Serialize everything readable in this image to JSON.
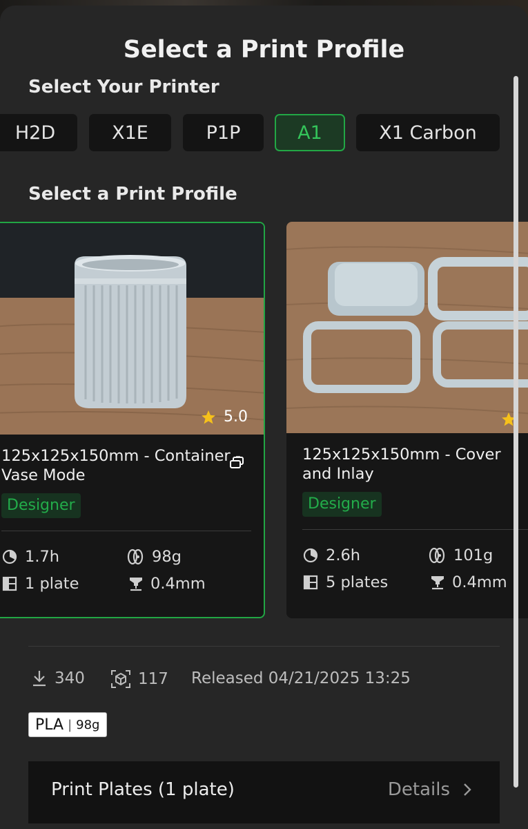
{
  "title": "Select a Print Profile",
  "printer_section": {
    "label": "Select Your Printer",
    "printers": [
      {
        "label": "H2D",
        "selected": false
      },
      {
        "label": "X1E",
        "selected": false
      },
      {
        "label": "P1P",
        "selected": false
      },
      {
        "label": "A1",
        "selected": true
      },
      {
        "label": "X1 Carbon",
        "selected": false
      }
    ]
  },
  "profile_section": {
    "label": "Select a Print Profile",
    "cards": [
      {
        "title": "125x125x150mm - Container - Vase Mode",
        "badge": "Designer",
        "rating": "5.0",
        "time": "1.7h",
        "weight": "98g",
        "plates": "1 plate",
        "nozzle": "0.4mm",
        "selected": true
      },
      {
        "title": "125x125x150mm - Cover and Inlay",
        "badge": "Designer",
        "time": "2.6h",
        "weight": "101g",
        "plates": "5 plates",
        "nozzle": "0.4mm",
        "selected": false
      }
    ]
  },
  "meta": {
    "downloads": "340",
    "prints": "117",
    "released": "Released 04/21/2025 13:25"
  },
  "filament": {
    "material": "PLA",
    "weight": "98g"
  },
  "print_plates": {
    "label": "Print Plates (1 plate)",
    "details_label": "Details"
  },
  "colors": {
    "accent": "#22a745",
    "background": "#262626",
    "card": "#161616"
  }
}
